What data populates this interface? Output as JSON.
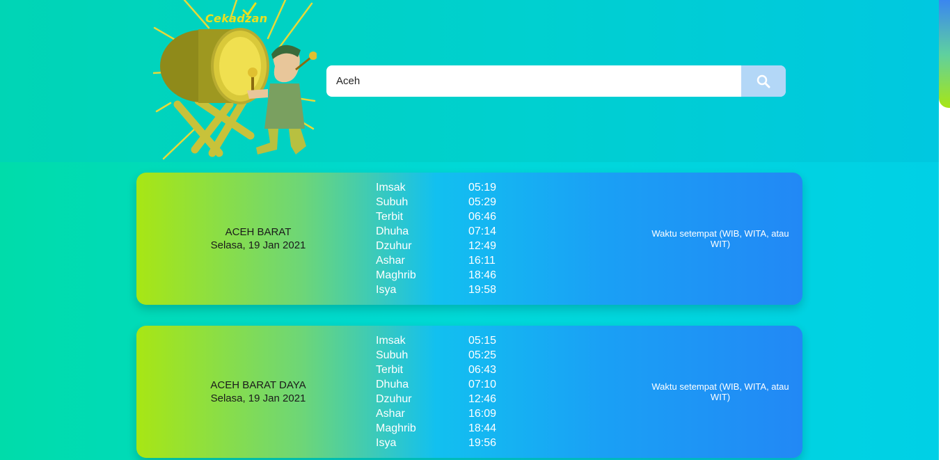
{
  "header": {
    "logo_text": "Cekadzan",
    "search": {
      "value": "Aceh",
      "button_icon": "search-icon"
    }
  },
  "cards": [
    {
      "region": "ACEH BARAT",
      "date": "Selasa, 19 Jan 2021",
      "times": [
        {
          "name": "Imsak",
          "time": "05:19"
        },
        {
          "name": "Subuh",
          "time": "05:29"
        },
        {
          "name": "Terbit",
          "time": "06:46"
        },
        {
          "name": "Dhuha",
          "time": "07:14"
        },
        {
          "name": "Dzuhur",
          "time": "12:49"
        },
        {
          "name": "Ashar",
          "time": "16:11"
        },
        {
          "name": "Maghrib",
          "time": "18:46"
        },
        {
          "name": "Isya",
          "time": "19:58"
        }
      ],
      "note": "Waktu setempat (WIB, WITA, atau WIT)"
    },
    {
      "region": "ACEH BARAT DAYA",
      "date": "Selasa, 19 Jan 2021",
      "times": [
        {
          "name": "Imsak",
          "time": "05:15"
        },
        {
          "name": "Subuh",
          "time": "05:25"
        },
        {
          "name": "Terbit",
          "time": "06:43"
        },
        {
          "name": "Dhuha",
          "time": "07:10"
        },
        {
          "name": "Dzuhur",
          "time": "12:46"
        },
        {
          "name": "Ashar",
          "time": "16:09"
        },
        {
          "name": "Maghrib",
          "time": "18:44"
        },
        {
          "name": "Isya",
          "time": "19:56"
        }
      ],
      "note": "Waktu setempat (WIB, WITA, atau WIT)"
    }
  ],
  "colors": {
    "card_start": "#a8e614",
    "card_end": "#2288f5",
    "search_button": "#b3d7f7"
  }
}
